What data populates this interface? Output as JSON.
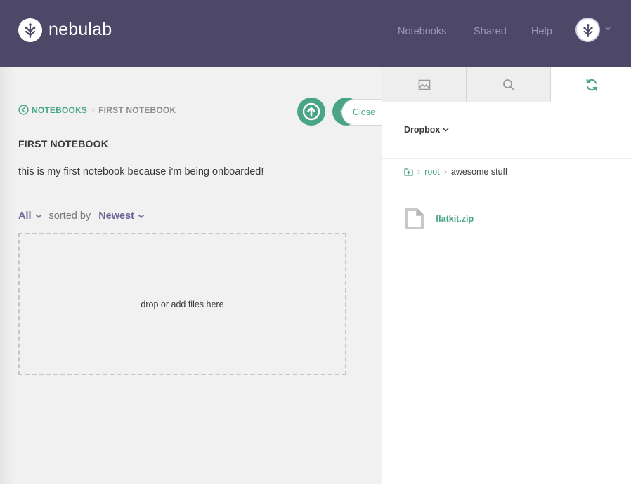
{
  "header": {
    "brand": "nebulab",
    "nav": [
      "Notebooks",
      "Shared",
      "Help"
    ]
  },
  "breadcrumb": {
    "parent": "NOTEBOOKS",
    "current": "FIRST NOTEBOOK"
  },
  "notebook": {
    "title": "FIRST NOTEBOOK",
    "description": "this is my first notebook because i'm being onboarded!"
  },
  "close_label": "Close",
  "filter": {
    "scope": "All",
    "sorted_by_label": "sorted by",
    "sort": "Newest"
  },
  "dropzone_text": "drop or add files here",
  "right_panel": {
    "tabs": [
      "image-icon",
      "search-icon",
      "sync-icon"
    ],
    "active_tab": 2,
    "source": "Dropbox",
    "path": [
      "root",
      "awesome stuff"
    ],
    "files": [
      {
        "name": "flatkit.zip",
        "icon": "file-icon"
      }
    ]
  },
  "colors": {
    "header_bg": "#4d4868",
    "accent": "#4aa588",
    "nav_text": "#9d98b7",
    "filter_text": "#6e6796",
    "left_bg": "#f1f1f1"
  }
}
